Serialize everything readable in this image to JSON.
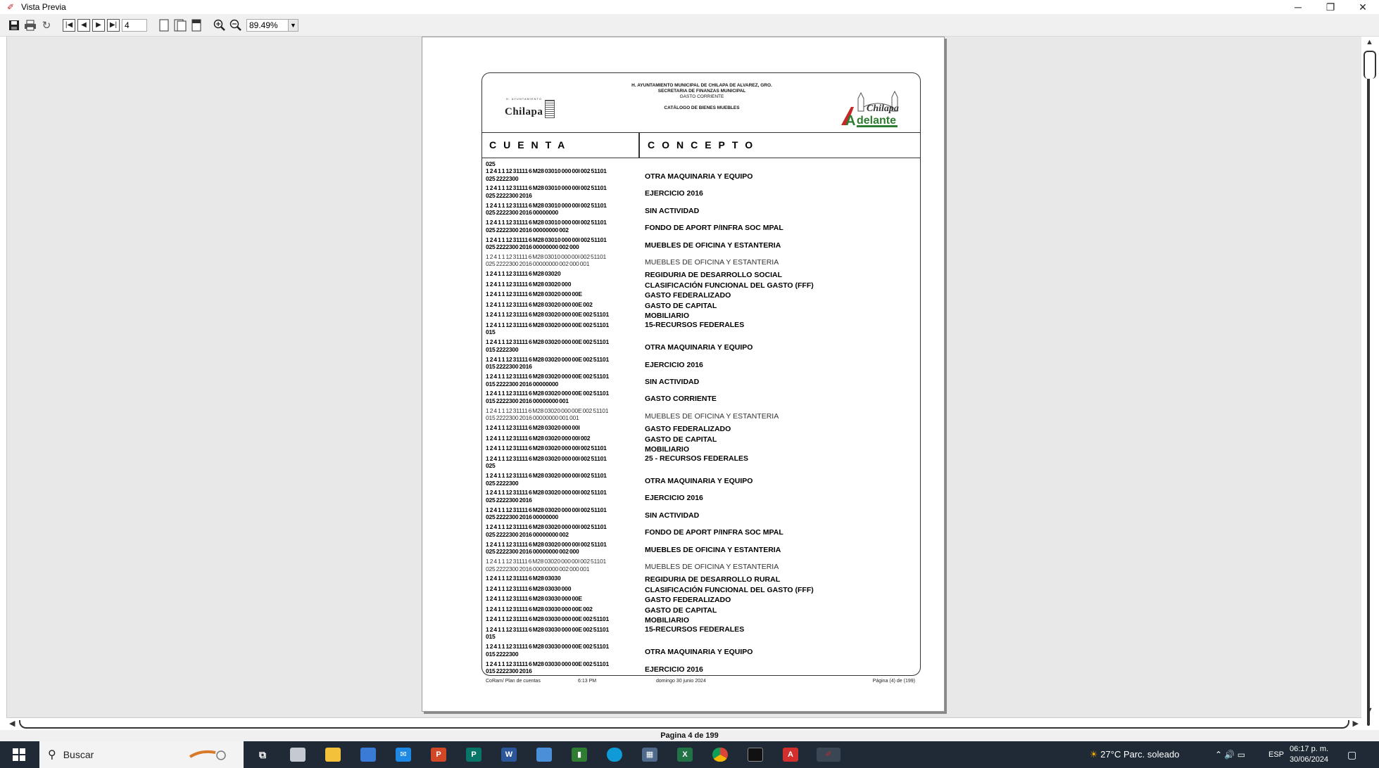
{
  "window": {
    "title": "Vista Previa",
    "icon": "pdf-viewer-icon",
    "minimize": "─",
    "restore": "❐",
    "close": "✕"
  },
  "toolbar": {
    "page_number": "4",
    "zoom": "89.49%",
    "icons": [
      "save-icon",
      "print-icon",
      "refresh-icon",
      "first-page-icon",
      "prev-page-icon",
      "next-page-icon",
      "last-page-icon",
      "single-page-icon",
      "two-page-icon",
      "page-width-icon",
      "zoom-in-icon",
      "zoom-out-icon"
    ]
  },
  "status": {
    "page_indicator": "Pagina 4 de 199"
  },
  "document": {
    "header": {
      "line1": "H. AYUNTAMIENTO MUNICIPAL DE CHILAPA DE ALVAREZ, GRO.",
      "line2": "SECRETARIA DE FINANZAS MUNICIPAL",
      "line3": "GASTO CORRIENTE",
      "line4": "CATÁLOGO DE BIENES MUEBLES",
      "logo_left": "Chilapa",
      "logo_left_small": "H. AYUNTAMIENTO",
      "logo_right_top": "Chilapa",
      "logo_right_bottom": "delante",
      "logo_right_letter": "A"
    },
    "columns": {
      "cuenta": "CUENTA",
      "concepto": "CONCEPTO"
    },
    "rows": [
      {
        "acct": "025",
        "conc": "",
        "kind": "solo"
      },
      {
        "acct": "1 2 4 1 1 12 31111 6 M28 03010 000 00I 002 51101\n025 2222300",
        "conc": "OTRA MAQUINARIA Y EQUIPO",
        "kind": "two"
      },
      {
        "acct": "1 2 4 1 1 12 31111 6 M28 03010 000 00I 002 51101\n025 2222300 2016",
        "conc": "EJERCICIO 2016",
        "kind": "two"
      },
      {
        "acct": "1 2 4 1 1 12 31111 6 M28 03010 000 00I 002 51101\n025 2222300 2016 00000000",
        "conc": "SIN ACTIVIDAD",
        "kind": "two"
      },
      {
        "acct": "1 2 4 1 1 12 31111 6 M28 03010 000 00I 002 51101\n025 2222300 2016 00000000 002",
        "conc": "FONDO DE APORT P/INFRA SOC MPAL",
        "kind": "two"
      },
      {
        "acct": "1 2 4 1 1 12 31111 6 M28 03010 000 00I 002 51101\n025 2222300 2016 00000000 002 000",
        "conc": "MUEBLES DE OFICINA Y ESTANTERIA",
        "kind": "two"
      },
      {
        "acct": "1 2 4 1 1 12 31111 6 M28 03010 000 00I 002 51101\n025 2222300 2016 00000000 002 000 001",
        "conc": "MUEBLES DE OFICINA Y ESTANTERIA",
        "kind": "two",
        "light": true
      },
      {
        "acct": "1 2 4 1 1 12 31111 6 M28 03020",
        "conc": "REGIDURIA DE DESARROLLO SOCIAL",
        "kind": "one"
      },
      {
        "acct": "1 2 4 1 1 12 31111 6 M28 03020 000",
        "conc": "CLASIFICACIÓN FUNCIONAL DEL GASTO (FFF)",
        "kind": "one"
      },
      {
        "acct": "1 2 4 1 1 12 31111 6 M28 03020 000 00E",
        "conc": "GASTO FEDERALIZADO",
        "kind": "one"
      },
      {
        "acct": "1 2 4 1 1 12 31111 6 M28 03020 000 00E 002",
        "conc": "GASTO DE CAPITAL",
        "kind": "one"
      },
      {
        "acct": "1 2 4 1 1 12 31111 6 M28 03020 000 00E 002 51101",
        "conc": "MOBILIARIO",
        "kind": "one"
      },
      {
        "acct": "1 2 4 1 1 12 31111 6 M28 03020 000 00E 002 51101\n015",
        "conc": "15-RECURSOS FEDERALES",
        "kind": "two",
        "top": true
      },
      {
        "acct": "1 2 4 1 1 12 31111 6 M28 03020 000 00E 002 51101\n015 2222300",
        "conc": "OTRA MAQUINARIA Y EQUIPO",
        "kind": "two"
      },
      {
        "acct": "1 2 4 1 1 12 31111 6 M28 03020 000 00E 002 51101\n015 2222300 2016",
        "conc": "EJERCICIO 2016",
        "kind": "two"
      },
      {
        "acct": "1 2 4 1 1 12 31111 6 M28 03020 000 00E 002 51101\n015 2222300 2016 00000000",
        "conc": "SIN ACTIVIDAD",
        "kind": "two"
      },
      {
        "acct": "1 2 4 1 1 12 31111 6 M28 03020 000 00E 002 51101\n015 2222300 2016 00000000 001",
        "conc": "GASTO CORRIENTE",
        "kind": "two"
      },
      {
        "acct": "1 2 4 1 1 12 31111 6 M28 03020 000 00E 002 51101\n015 2222300 2016 00000000 001 001",
        "conc": "MUEBLES DE OFICINA Y ESTANTERIA",
        "kind": "two",
        "light": true
      },
      {
        "acct": "1 2 4 1 1 12 31111 6 M28 03020 000 00I",
        "conc": "GASTO FEDERALIZADO",
        "kind": "one"
      },
      {
        "acct": "1 2 4 1 1 12 31111 6 M28 03020 000 00I 002",
        "conc": "GASTO DE CAPITAL",
        "kind": "one"
      },
      {
        "acct": "1 2 4 1 1 12 31111 6 M28 03020 000 00I 002 51101",
        "conc": "MOBILIARIO",
        "kind": "one"
      },
      {
        "acct": "1 2 4 1 1 12 31111 6 M28 03020 000 00I 002 51101\n025",
        "conc": "25 - RECURSOS FEDERALES",
        "kind": "two",
        "top": true
      },
      {
        "acct": "1 2 4 1 1 12 31111 6 M28 03020 000 00I 002 51101\n025 2222300",
        "conc": "OTRA MAQUINARIA Y EQUIPO",
        "kind": "two"
      },
      {
        "acct": "1 2 4 1 1 12 31111 6 M28 03020 000 00I 002 51101\n025 2222300 2016",
        "conc": "EJERCICIO 2016",
        "kind": "two"
      },
      {
        "acct": "1 2 4 1 1 12 31111 6 M28 03020 000 00I 002 51101\n025 2222300 2016 00000000",
        "conc": "SIN ACTIVIDAD",
        "kind": "two"
      },
      {
        "acct": "1 2 4 1 1 12 31111 6 M28 03020 000 00I 002 51101\n025 2222300 2016 00000000 002",
        "conc": "FONDO DE APORT P/INFRA SOC MPAL",
        "kind": "two"
      },
      {
        "acct": "1 2 4 1 1 12 31111 6 M28 03020 000 00I 002 51101\n025 2222300 2016 00000000 002 000",
        "conc": "MUEBLES DE OFICINA Y ESTANTERIA",
        "kind": "two"
      },
      {
        "acct": "1 2 4 1 1 12 31111 6 M28 03020 000 00I 002 51101\n025 2222300 2016 00000000 002 000 001",
        "conc": "MUEBLES DE OFICINA Y ESTANTERIA",
        "kind": "two",
        "light": true
      },
      {
        "acct": "1 2 4 1 1 12 31111 6 M28 03030",
        "conc": "REGIDURIA DE DESARROLLO RURAL",
        "kind": "one"
      },
      {
        "acct": "1 2 4 1 1 12 31111 6 M28 03030 000",
        "conc": "CLASIFICACIÓN FUNCIONAL DEL GASTO (FFF)",
        "kind": "one"
      },
      {
        "acct": "1 2 4 1 1 12 31111 6 M28 03030 000 00E",
        "conc": "GASTO FEDERALIZADO",
        "kind": "one"
      },
      {
        "acct": "1 2 4 1 1 12 31111 6 M28 03030 000 00E 002",
        "conc": "GASTO DE CAPITAL",
        "kind": "one"
      },
      {
        "acct": "1 2 4 1 1 12 31111 6 M28 03030 000 00E 002 51101",
        "conc": "MOBILIARIO",
        "kind": "one"
      },
      {
        "acct": "1 2 4 1 1 12 31111 6 M28 03030 000 00E 002 51101\n015",
        "conc": "15-RECURSOS FEDERALES",
        "kind": "two",
        "top": true
      },
      {
        "acct": "1 2 4 1 1 12 31111 6 M28 03030 000 00E 002 51101\n015 2222300",
        "conc": "OTRA MAQUINARIA Y EQUIPO",
        "kind": "two"
      },
      {
        "acct": "1 2 4 1 1 12 31111 6 M28 03030 000 00E 002 51101\n015 2222300 2016",
        "conc": "EJERCICIO 2016",
        "kind": "two"
      }
    ],
    "footer": {
      "source": "CoRam/ Plan de cuentas",
      "time": "6:13 PM",
      "date": "domingo 30 junio 2024",
      "page": "Página (4) de (199)"
    }
  },
  "taskbar": {
    "search_placeholder": "Buscar",
    "weather": "27°C  Parc. soleado",
    "language": "ESP",
    "time": "06:17 p. m.",
    "date": "30/06/2024",
    "apps": [
      "task-view-icon",
      "file-icon",
      "file-explorer-icon",
      "store-icon",
      "mail-icon",
      "powerpoint-icon",
      "publisher-icon",
      "word-icon",
      "remote-desktop-icon",
      "chart-app-icon",
      "edge-icon",
      "calculator-icon",
      "excel-icon",
      "chrome-icon",
      "terminal-icon",
      "acrobat-icon",
      "pdf-viewer-icon"
    ]
  }
}
